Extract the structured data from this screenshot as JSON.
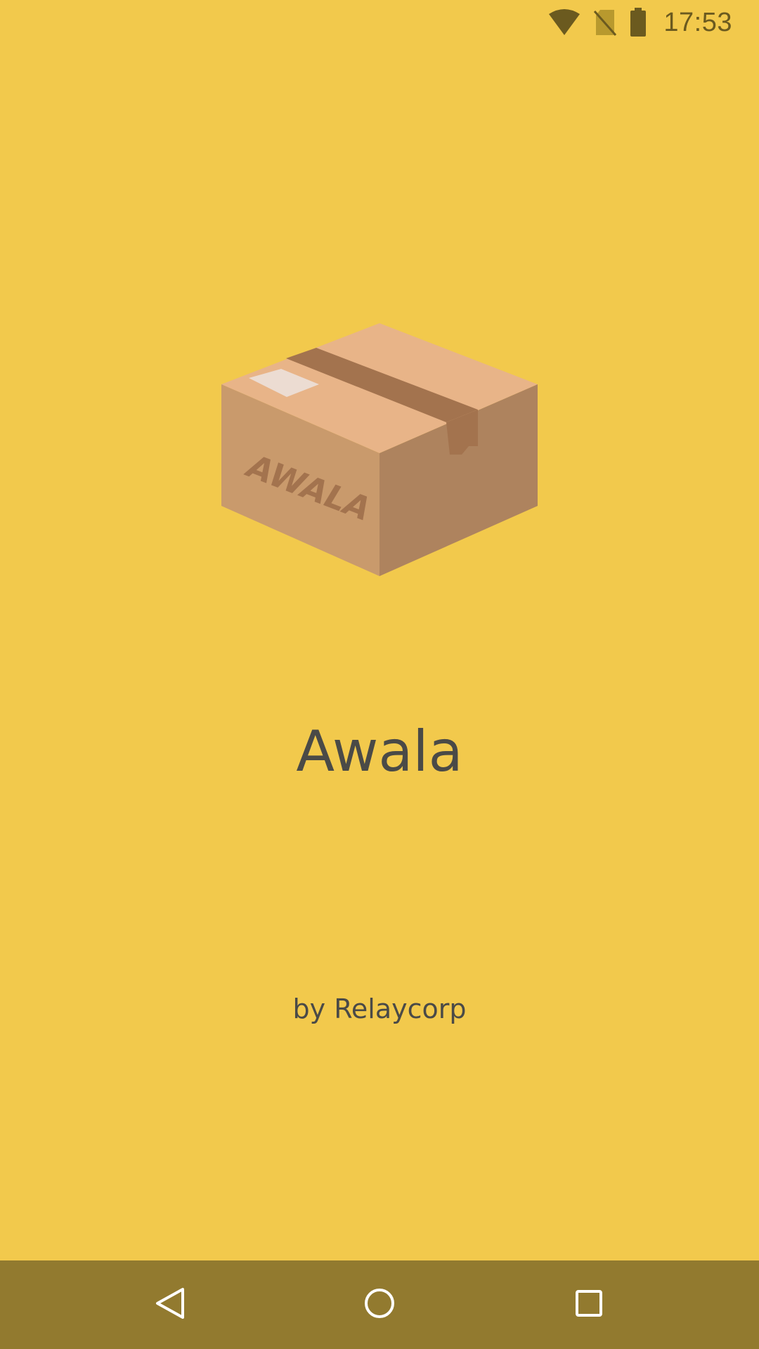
{
  "status_bar": {
    "time": "17:53",
    "icons": [
      "wifi-icon",
      "no-sim-icon",
      "battery-icon"
    ],
    "icon_color": "#6B5A1F"
  },
  "splash": {
    "illustration": "cardboard-box-logo",
    "box_label": "AWALA",
    "title": "Awala",
    "byline": "by Relaycorp"
  },
  "nav_bar": {
    "buttons": [
      "back-icon",
      "home-icon",
      "recents-icon"
    ],
    "background": "#927A2F"
  },
  "colors": {
    "background": "#F2C94C",
    "text": "#4A4A47"
  }
}
